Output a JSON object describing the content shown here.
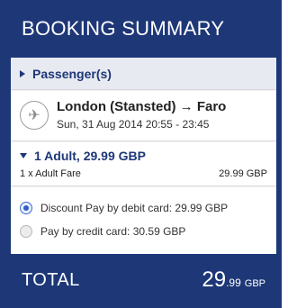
{
  "header": {
    "title": "BOOKING SUMMARY"
  },
  "passengers": {
    "label": "Passenger(s)"
  },
  "flight": {
    "icon": "airplane-icon",
    "route": "London (Stansted) → Faro",
    "datetime": "Sun, 31 Aug 2014 20:55 - 23:45"
  },
  "fare": {
    "heading": "1 Adult, 29.99 GBP",
    "line_label": "1 x Adult Fare",
    "line_value": "29.99 GBP"
  },
  "payment": {
    "options": [
      {
        "label": "Discount Pay by debit card: 29.99 GBP",
        "selected": true
      },
      {
        "label": "Pay by credit card: 30.59 GBP",
        "selected": false
      }
    ]
  },
  "total": {
    "label": "TOTAL",
    "amount_major": "29",
    "amount_minor": ".99",
    "currency": "GBP"
  },
  "colors": {
    "brand": "#1d3777",
    "panel_bg": "#f1f1f1",
    "radio_selected": "#2f5fc4"
  }
}
